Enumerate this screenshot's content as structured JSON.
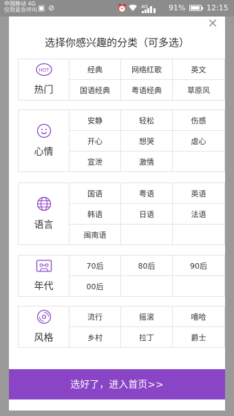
{
  "statusbar": {
    "carrier_1": "中国移动 4G",
    "carrier_2": "仅限紧急呼叫",
    "network": "4G",
    "battery": "91%",
    "battery_level": 0.91,
    "time": "12:15"
  },
  "dialog": {
    "close_icon": "✕",
    "title": "选择你感兴趣的分类（可多选）",
    "confirm_label": "选好了，进入首页>>"
  },
  "groups": [
    {
      "label": "热门",
      "icon": "hot-icon",
      "icon_text": "HOT",
      "items": [
        "经典",
        "网络红歌",
        "英文",
        "国语经典",
        "粤语经典",
        "草原风"
      ]
    },
    {
      "label": "心情",
      "icon": "smile-icon",
      "items": [
        "安静",
        "轻松",
        "伤感",
        "开心",
        "想哭",
        "虐心",
        "宣泄",
        "激情"
      ]
    },
    {
      "label": "语言",
      "icon": "globe-icon",
      "items": [
        "国语",
        "粤语",
        "英语",
        "韩语",
        "日语",
        "法语",
        "闽南语"
      ]
    },
    {
      "label": "年代",
      "icon": "cassette-icon",
      "items": [
        "70后",
        "80后",
        "90后",
        "00后"
      ]
    },
    {
      "label": "风格",
      "icon": "disc-icon",
      "items": [
        "流行",
        "摇滚",
        "嘻哈",
        "乡村",
        "拉丁",
        "爵士"
      ]
    }
  ],
  "accent_color": "#8a45c6"
}
